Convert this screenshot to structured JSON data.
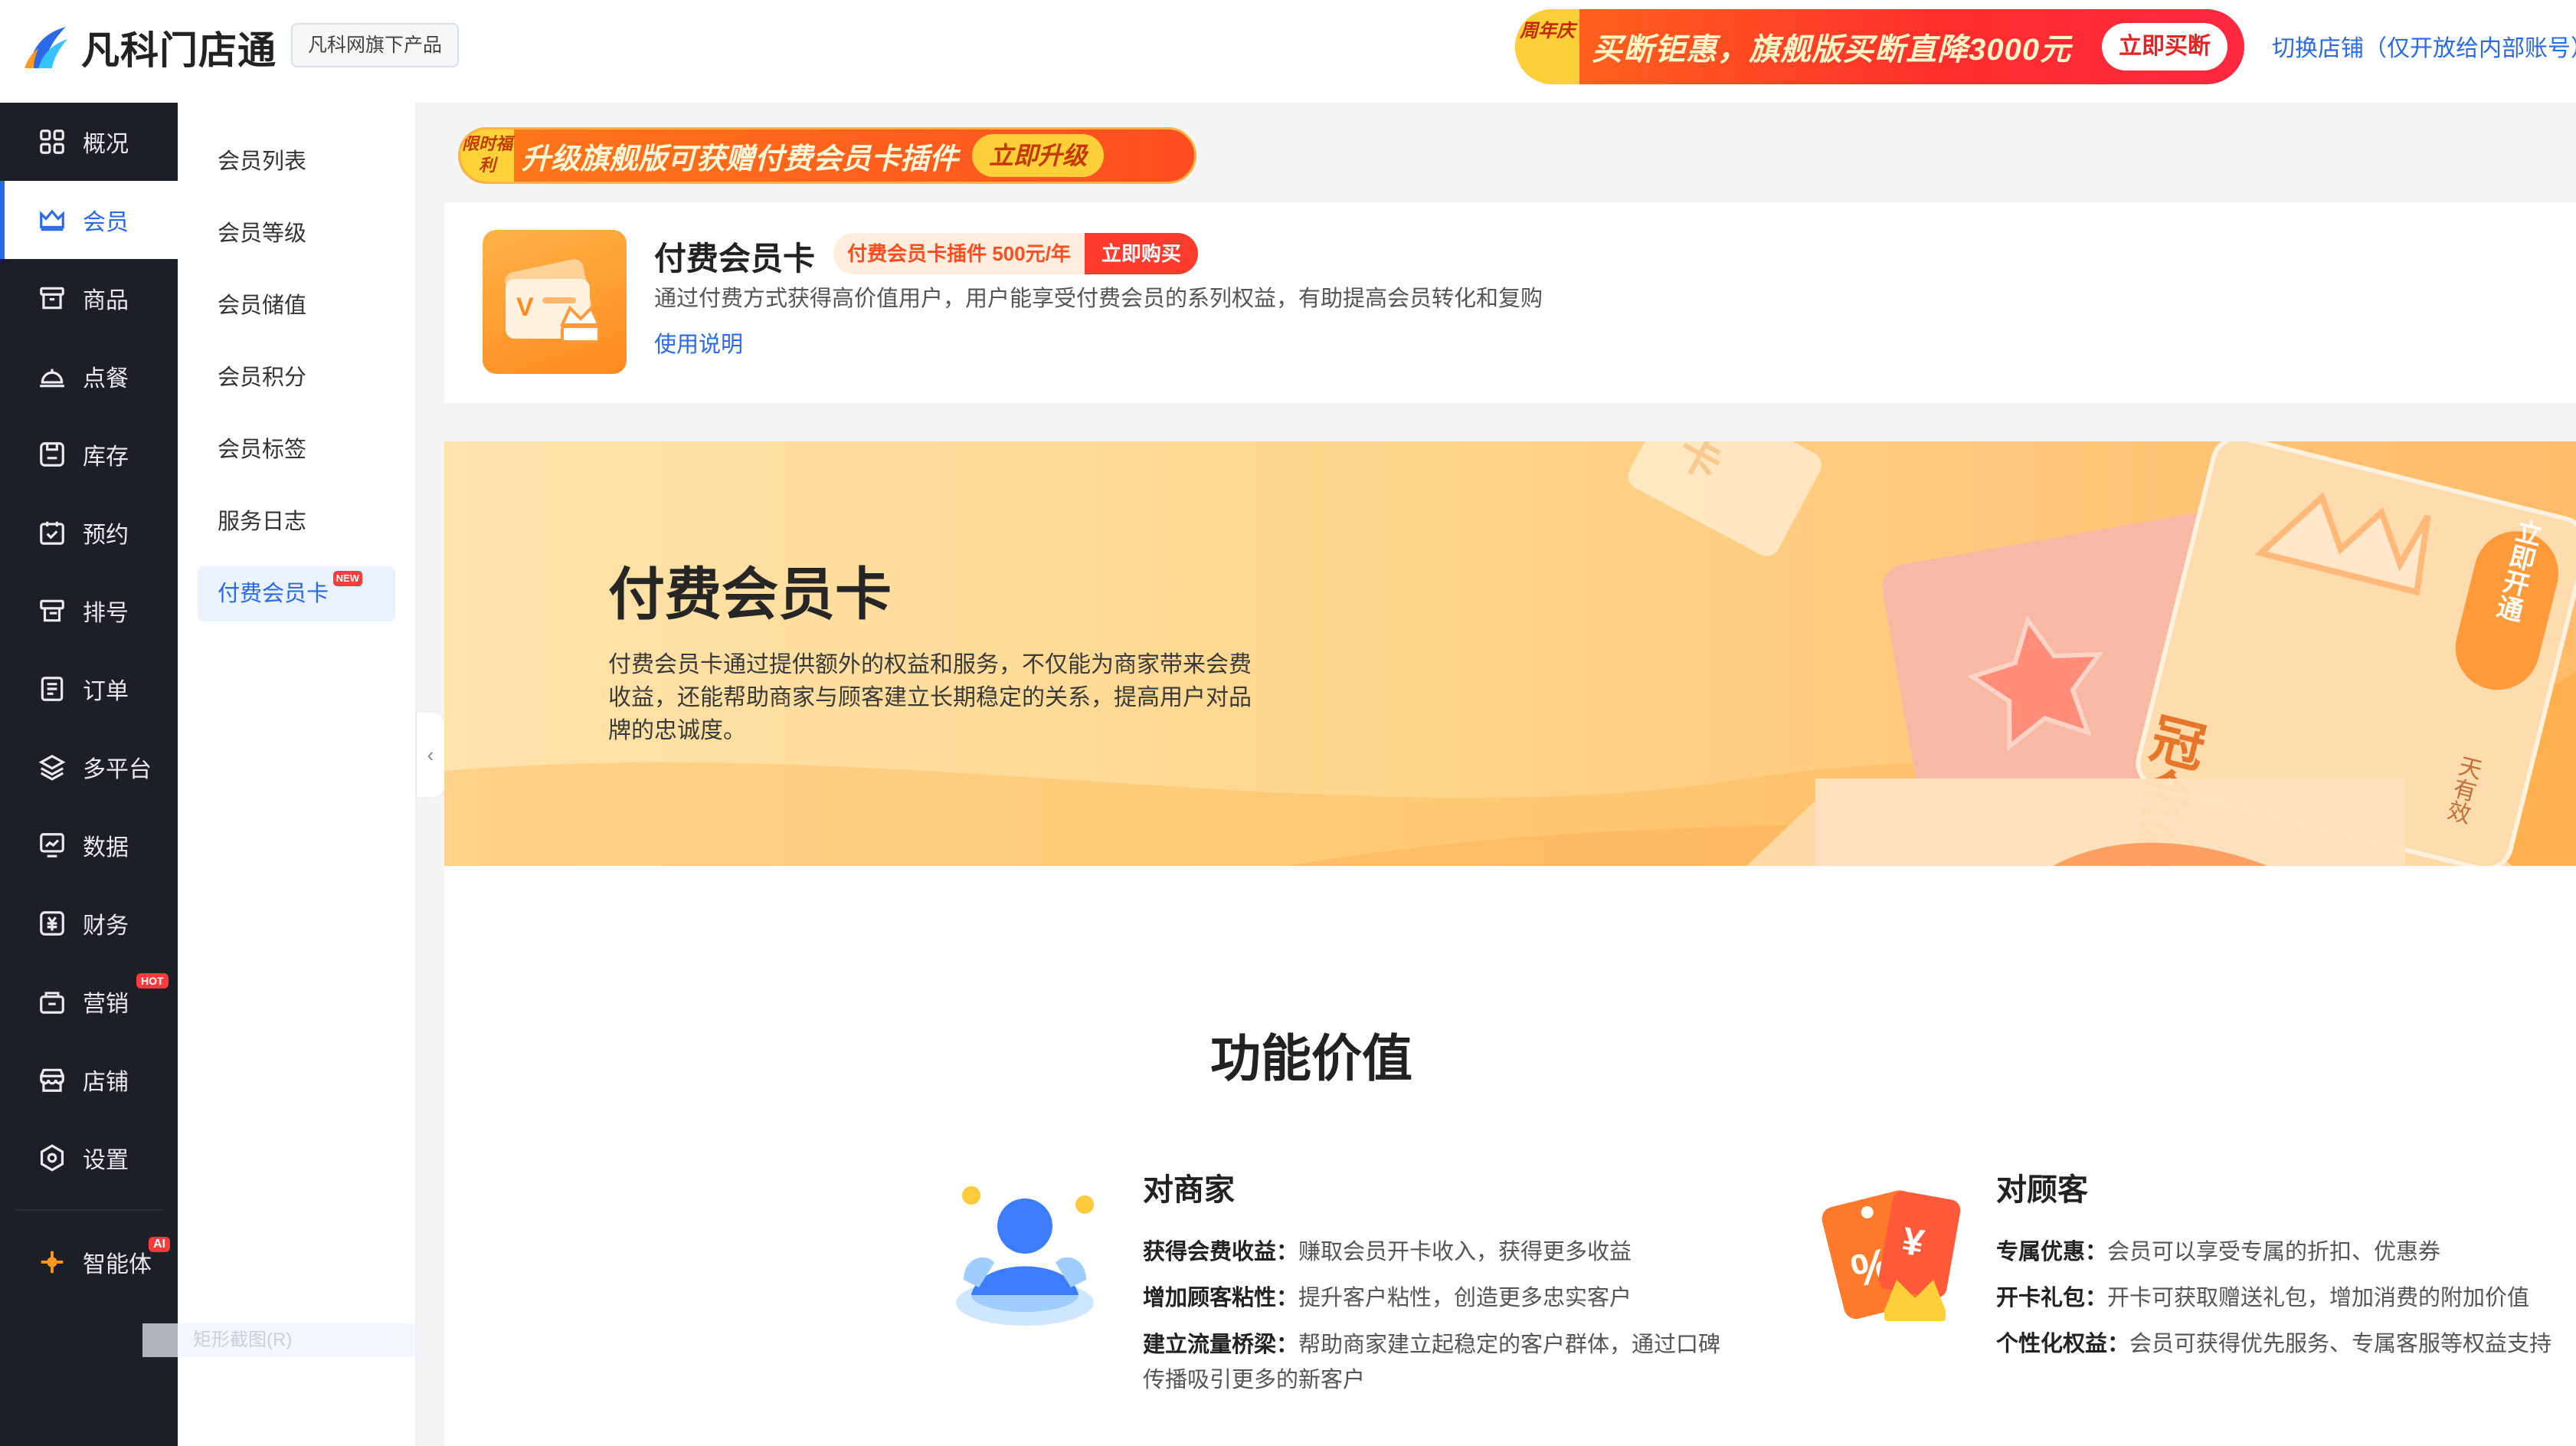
{
  "brand": {
    "name": "凡科门店通",
    "sub": "凡科网旗下产品"
  },
  "promo": {
    "badge": "周年庆",
    "text": "买断钜惠，旗舰版买断直降3000元",
    "button": "立即买断"
  },
  "switch_store": "切换店铺（仅开放给内部账号）",
  "sidebar": {
    "items": [
      {
        "label": "概况",
        "icon": "grid-icon"
      },
      {
        "label": "会员",
        "icon": "crown-icon"
      },
      {
        "label": "商品",
        "icon": "store-box-icon"
      },
      {
        "label": "点餐",
        "icon": "dish-icon"
      },
      {
        "label": "库存",
        "icon": "inventory-icon"
      },
      {
        "label": "预约",
        "icon": "calendar-check-icon"
      },
      {
        "label": "排号",
        "icon": "queue-icon"
      },
      {
        "label": "订单",
        "icon": "order-icon"
      },
      {
        "label": "多平台",
        "icon": "layers-icon"
      },
      {
        "label": "数据",
        "icon": "chart-icon"
      },
      {
        "label": "财务",
        "icon": "finance-icon"
      },
      {
        "label": "营销",
        "icon": "marketing-icon",
        "badge": "HOT"
      },
      {
        "label": "店铺",
        "icon": "shop-icon"
      },
      {
        "label": "设置",
        "icon": "settings-icon"
      }
    ],
    "agent": {
      "label": "智能体",
      "badge": "AI"
    }
  },
  "submenu": {
    "items": [
      "会员列表",
      "会员等级",
      "会员储值",
      "会员积分",
      "会员标签",
      "服务日志"
    ],
    "active": "付费会员卡",
    "active_badge": "NEW",
    "ghost": "矩形截图(R)"
  },
  "upgrade_strip": {
    "badge": "限时福利",
    "text": "升级旗舰版可获赠付费会员卡插件",
    "button": "立即升级"
  },
  "plugin": {
    "title": "付费会员卡",
    "price": "付费会员卡插件 500元/年",
    "buy": "立即购买",
    "desc": "通过付费方式获得高价值用户，用户能享受付费会员的系列权益，有助提高会员转化和复购",
    "link": "使用说明"
  },
  "hero": {
    "title": "付费会员卡",
    "desc": "付费会员卡通过提供额外的权益和服务，不仅能为商家带来会费收益，还能帮助商家与顾客建立长期稳定的关系，提高用户对品牌的忠诚度。",
    "card_cta": "立即开通",
    "card_text": "冠会员",
    "card_sub": "天有效",
    "ticket": "卡"
  },
  "section": {
    "title": "功能价值",
    "merchant": {
      "title": "对商家",
      "lines": [
        {
          "k": "获得会费收益：",
          "v": "赚取会员开卡收入，获得更多收益"
        },
        {
          "k": "增加顾客粘性：",
          "v": "提升客户粘性，创造更多忠实客户"
        },
        {
          "k": "建立流量桥梁：",
          "v": "帮助商家建立起稳定的客户群体，通过口碑传播吸引更多的新客户"
        }
      ]
    },
    "customer": {
      "title": "对顾客",
      "lines": [
        {
          "k": "专属优惠：",
          "v": "会员可以享受专属的折扣、优惠券"
        },
        {
          "k": "开卡礼包：",
          "v": "开卡可获取赠送礼包，增加消费的附加价值"
        },
        {
          "k": "个性化权益：",
          "v": "会员可获得优先服务、专属客服等权益支持"
        }
      ]
    }
  },
  "colors": {
    "accent": "#2a6ae8",
    "sidebar_bg": "#1c1f26",
    "promo": "#ff3b2e",
    "hero": "#ffd88f"
  }
}
